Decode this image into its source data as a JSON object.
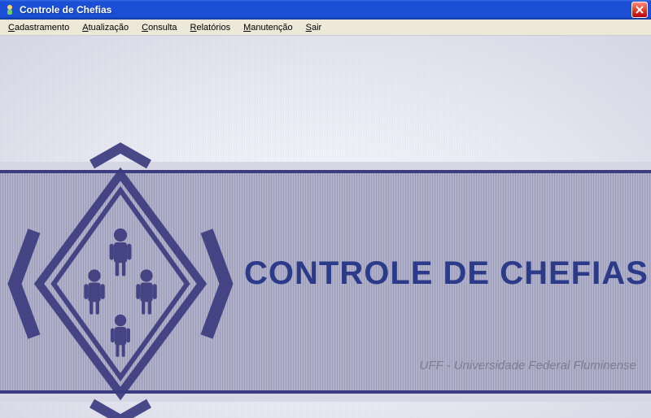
{
  "window": {
    "title": "Controle de Chefias"
  },
  "menu": {
    "items": [
      {
        "label": "Cadastramento",
        "hotkey_index": 0
      },
      {
        "label": "Atualização",
        "hotkey_index": 0
      },
      {
        "label": "Consulta",
        "hotkey_index": 0
      },
      {
        "label": "Relatórios",
        "hotkey_index": 0
      },
      {
        "label": "Manutenção",
        "hotkey_index": 0
      },
      {
        "label": "Sair",
        "hotkey_index": 0
      }
    ]
  },
  "splash": {
    "title": "CONTROLE DE CHEFIAS",
    "subtitle": "UFF - Universidade Federal Fluminense"
  },
  "colors": {
    "accent": "#2c3a8a",
    "titlebar": "#1b4fd6"
  }
}
